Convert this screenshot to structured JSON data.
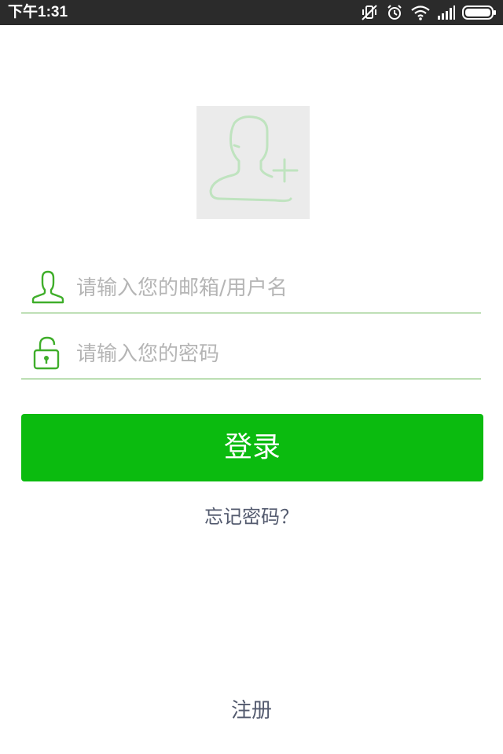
{
  "status_bar": {
    "time": "下午1:31",
    "icons": [
      "vibrate-off-icon",
      "alarm-icon",
      "wifi-icon",
      "signal-icon",
      "battery-icon"
    ]
  },
  "avatar": {
    "icon": "add-user-icon"
  },
  "login_form": {
    "username_placeholder": "请输入您的邮箱/用户名",
    "username_value": "",
    "password_placeholder": "请输入您的密码",
    "password_value": "",
    "login_label": "登录",
    "forgot_label": "忘记密码？",
    "register_label": "注册"
  },
  "colors": {
    "accent": "#0bbb0f",
    "underline": "#63b450",
    "link_text": "#535a6e",
    "placeholder": "#b5b5b5",
    "status_bar": "#2b2b2b"
  }
}
